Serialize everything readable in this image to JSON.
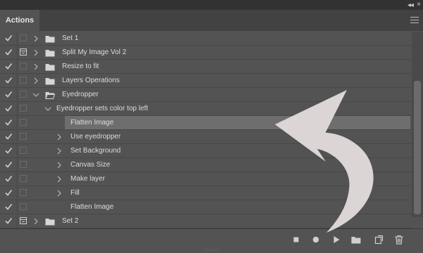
{
  "panel": {
    "title": "Actions",
    "collapse_glyph": "◂◂",
    "close_glyph": "×"
  },
  "rows": [
    {
      "label": "Set 1",
      "check": true,
      "dialog": false,
      "type": "set",
      "expanded": false,
      "indent": 0
    },
    {
      "label": "Split My Image Vol 2",
      "check": true,
      "dialog": true,
      "type": "set",
      "expanded": false,
      "indent": 0
    },
    {
      "label": "Resize to fit",
      "check": true,
      "dialog": false,
      "type": "set",
      "expanded": false,
      "indent": 0
    },
    {
      "label": "Layers Operations",
      "check": true,
      "dialog": false,
      "type": "set",
      "expanded": false,
      "indent": 0
    },
    {
      "label": "Eyedropper",
      "check": true,
      "dialog": false,
      "type": "set",
      "expanded": true,
      "indent": 0
    },
    {
      "label": "Eyedropper sets color top left",
      "check": true,
      "dialog": false,
      "type": "action",
      "expanded": true,
      "indent": 1
    },
    {
      "label": "Flatten Image",
      "check": true,
      "dialog": false,
      "type": "step",
      "expandable": false,
      "indent": 2,
      "selected": true
    },
    {
      "label": "Use eyedropper",
      "check": true,
      "dialog": false,
      "type": "step",
      "expandable": true,
      "indent": 2
    },
    {
      "label": "Set Background",
      "check": true,
      "dialog": false,
      "type": "step",
      "expandable": true,
      "indent": 2
    },
    {
      "label": "Canvas Size",
      "check": true,
      "dialog": false,
      "type": "step",
      "expandable": true,
      "indent": 2
    },
    {
      "label": "Make layer",
      "check": true,
      "dialog": false,
      "type": "step",
      "expandable": true,
      "indent": 2
    },
    {
      "label": "Fill",
      "check": true,
      "dialog": false,
      "type": "step",
      "expandable": true,
      "indent": 2
    },
    {
      "label": "Flatten Image",
      "check": true,
      "dialog": false,
      "type": "step",
      "expandable": false,
      "indent": 2
    },
    {
      "label": "Set 2",
      "check": true,
      "dialog": true,
      "type": "set",
      "expanded": false,
      "indent": 0
    }
  ],
  "footer_buttons": [
    {
      "name": "stop-button",
      "icon": "stop-icon"
    },
    {
      "name": "record-button",
      "icon": "record-icon"
    },
    {
      "name": "play-button",
      "icon": "play-icon"
    },
    {
      "name": "new-set-button",
      "icon": "folder-icon"
    },
    {
      "name": "new-action-button",
      "icon": "new-icon"
    },
    {
      "name": "delete-button",
      "icon": "trash-icon"
    }
  ],
  "colors": {
    "arrow": "#dcd5d5",
    "panel": "#535353",
    "check": "#cfcfcf"
  }
}
